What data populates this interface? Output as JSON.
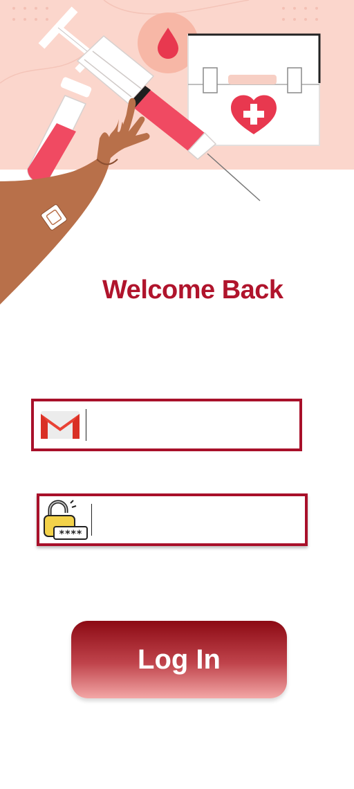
{
  "header": {
    "title": "Welcome Back"
  },
  "form": {
    "email": {
      "value": "",
      "placeholder": "",
      "icon": "gmail-icon"
    },
    "password": {
      "value": "",
      "placeholder": "",
      "icon": "padlock-password-icon",
      "icon_text": "****"
    },
    "login_label": "Log In"
  },
  "colors": {
    "accent": "#b0142c",
    "hero_background": "#fbd6cc",
    "button_gradient_top": "#8c0a14",
    "button_gradient_bottom": "#f3a7a6"
  }
}
